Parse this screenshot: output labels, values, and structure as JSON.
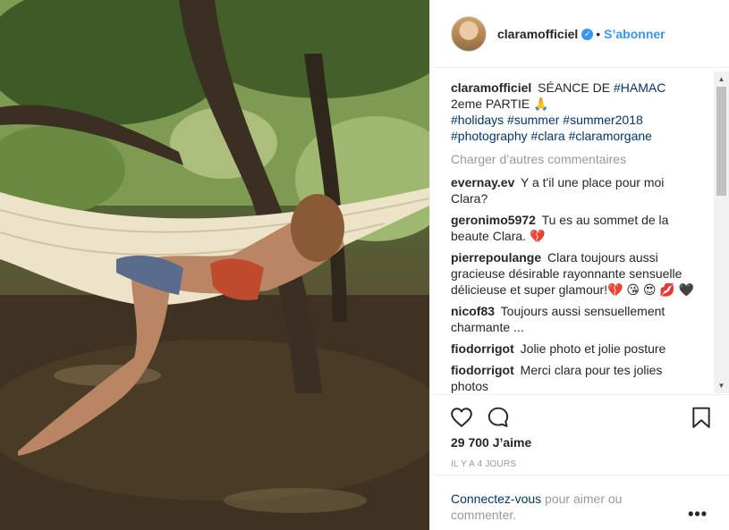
{
  "post": {
    "username": "claramofficiel",
    "follow_label": "S’abonner",
    "separator": "•",
    "verified_glyph": "✓",
    "caption": {
      "text": "SÉANCE DE ",
      "tag1": "#HAMAC",
      "text2": " 2eme PARTIE 🙏",
      "hashtags": [
        "#holidays",
        "#summer",
        "#summer2018",
        "#photography",
        "#clara",
        "#claramorgane"
      ]
    },
    "load_more_label": "Charger d’autres commentaires",
    "comments": [
      {
        "user": "evernay.ev",
        "text": "Y a t'il une place pour moi Clara?"
      },
      {
        "user": "geronimo5972",
        "text": "Tu es au sommet de la beaute Clara. 💔"
      },
      {
        "user": "pierrepoulange",
        "text": "Clara toujours aussi gracieuse désirable rayonnante sensuelle délicieuse et super glamour!💔 😘 😍 💋 🖤"
      },
      {
        "user": "nicof83",
        "text": "Toujours aussi sensuellement charmante ..."
      },
      {
        "user": "fiodorrigot",
        "text": "Jolie photo et jolie posture"
      },
      {
        "user": "fiodorrigot",
        "text": "Merci clara pour tes jolies photos"
      }
    ],
    "likes": "29 700 J’aime",
    "timestamp": "IL Y A 4 JOURS",
    "login_link": "Connectez-vous",
    "login_text": " pour aimer ou commenter.",
    "more_label": "•••"
  },
  "icons": {
    "like": "heart-icon",
    "comment": "speech-bubble-icon",
    "save": "bookmark-icon",
    "more": "ellipsis-icon",
    "verified": "verified-badge-icon"
  },
  "colors": {
    "accent": "#3897f0",
    "link": "#003569",
    "muted": "#999999"
  }
}
